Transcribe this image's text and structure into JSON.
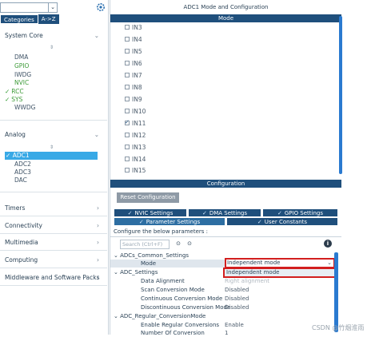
{
  "left": {
    "tabs": [
      "Categories",
      "A->Z"
    ],
    "categories": [
      {
        "label": "System Core",
        "expanded": true
      },
      {
        "label": "Analog",
        "expanded": true
      },
      {
        "label": "Timers",
        "expanded": false
      },
      {
        "label": "Connectivity",
        "expanded": false
      },
      {
        "label": "Multimedia",
        "expanded": false
      },
      {
        "label": "Computing",
        "expanded": false
      },
      {
        "label": "Middleware and Software Packs",
        "expanded": false
      }
    ],
    "system_core_items": [
      "DMA",
      "GPIO",
      "IWDG",
      "NVIC",
      "RCC",
      "SYS",
      "WWDG"
    ],
    "analog_items": [
      "ADC1",
      "ADC2",
      "ADC3",
      "DAC"
    ]
  },
  "right": {
    "title": "ADC1 Mode and Configuration",
    "mode_header": "Mode",
    "inputs": [
      "IN3",
      "IN4",
      "IN5",
      "IN6",
      "IN7",
      "IN8",
      "IN9",
      "IN10",
      "IN11",
      "IN12",
      "IN13",
      "IN14",
      "IN15"
    ],
    "inputs_checked": [
      "IN11"
    ],
    "config_header": "Configuration",
    "reset_button": "Reset Configuration",
    "tabs_row1": [
      "NVIC Settings",
      "DMA Settings",
      "GPIO Settings"
    ],
    "tabs_row2": [
      "Parameter Settings",
      "User Constants"
    ],
    "configure_label": "Configure the below parameters :",
    "search_placeholder": "Search (Ctrl+F)",
    "params": {
      "group1": "ADCs_Common_Settings",
      "mode_label": "Mode",
      "mode_value": "Independent mode",
      "mode_option": "Independent mode",
      "group2": "ADC_Settings",
      "data_alignment_label": "Data Alignment",
      "data_alignment_value": "Right alignment",
      "scan_label": "Scan Conversion Mode",
      "scan_value": "Disabled",
      "continuous_label": "Continuous Conversion Mode",
      "continuous_value": "Disabled",
      "discontinuous_label": "Discontinuous Conversion Mode",
      "discontinuous_value": "Disabled",
      "group3": "ADC_Regular_ConversionMode",
      "enable_regular_label": "Enable Regular Conversions",
      "enable_regular_value": "Enable",
      "num_conversion_label": "Number Of Conversion",
      "num_conversion_value": "1"
    }
  },
  "watermark": "CSDN @竹烟淮雨"
}
